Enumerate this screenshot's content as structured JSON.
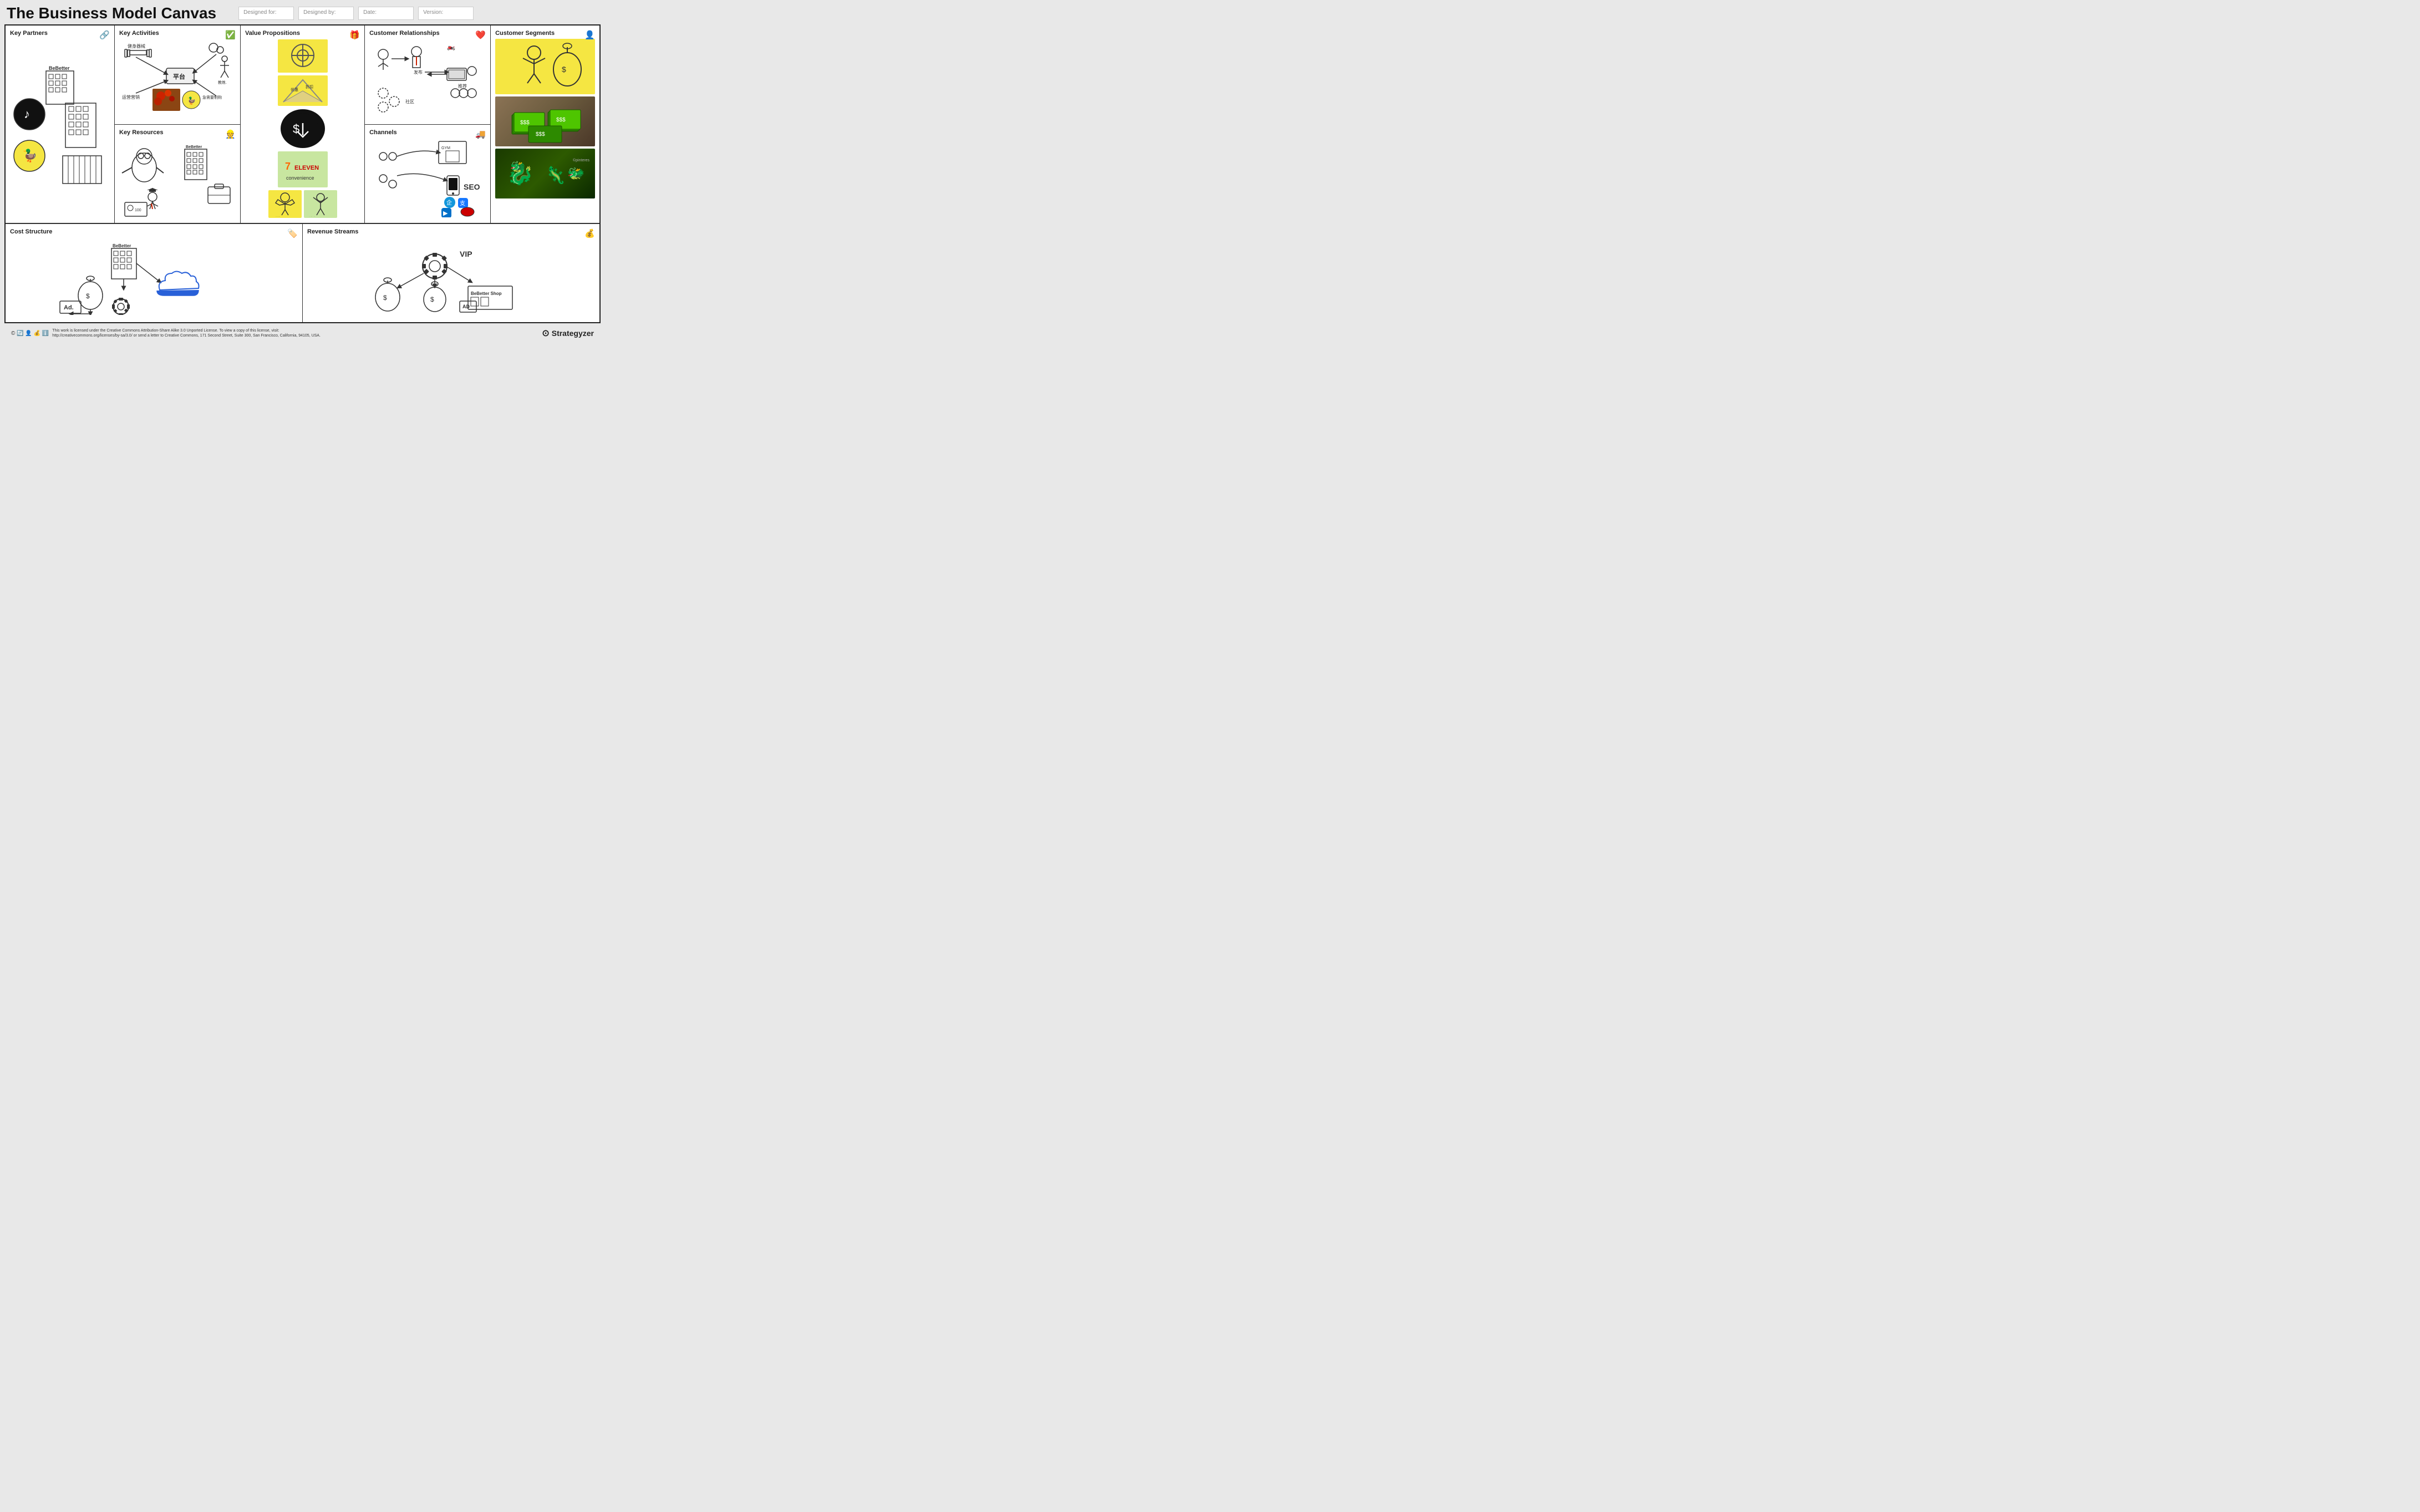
{
  "header": {
    "title": "The Business Model Canvas",
    "designed_for_label": "Designed for:",
    "designed_by_label": "Designed by:",
    "date_label": "Date:",
    "version_label": "Version:"
  },
  "canvas": {
    "key_partners": {
      "title": "Key Partners",
      "icon": "🔗"
    },
    "key_activities": {
      "title": "Key Activities",
      "icon": "✅"
    },
    "key_resources": {
      "title": "Key Resources",
      "icon": "👷"
    },
    "value_propositions": {
      "title": "Value Propositions",
      "icon": "🎁"
    },
    "customer_relationships": {
      "title": "Customer Relationships",
      "icon": "❤️"
    },
    "channels": {
      "title": "Channels",
      "icon": "🚚"
    },
    "customer_segments": {
      "title": "Customer Segments",
      "icon": "👤"
    },
    "cost_structure": {
      "title": "Cost Structure",
      "icon": "🏷️"
    },
    "revenue_streams": {
      "title": "Revenue Streams",
      "icon": "💰"
    }
  },
  "footer": {
    "license_icons": [
      "©",
      "🔄",
      "👤",
      "💰",
      "ℹ️"
    ],
    "license_text": "This work is licensed under the Creative Commons Attribution-Share Alike 3.0 Unported License. To view a copy of this license, visit:\nhttp://creativecommons.org/licenses/by-sa/3.0/ or send a letter to Creative Commons, 171 Second Street, Suite 300, San Francisco, California, 94105, USA.",
    "brand": "Strategyzer"
  }
}
